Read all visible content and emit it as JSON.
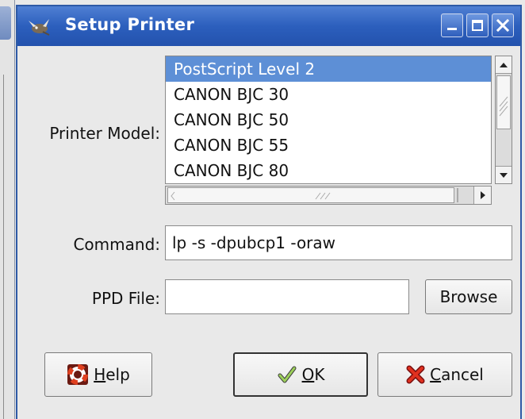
{
  "window": {
    "title": "Setup Printer"
  },
  "form": {
    "printer_model_label": "Printer Model:",
    "printer_models": [
      {
        "label": "PostScript Level 2",
        "selected": true
      },
      {
        "label": "CANON BJC 30",
        "selected": false
      },
      {
        "label": "CANON BJC 50",
        "selected": false
      },
      {
        "label": "CANON BJC 55",
        "selected": false
      },
      {
        "label": "CANON BJC 80",
        "selected": false
      }
    ],
    "command_label": "Command:",
    "command_value": "lp -s -dpubcp1 -oraw",
    "ppd_label": "PPD File:",
    "ppd_value": "",
    "browse_label": "Browse"
  },
  "buttons": {
    "help_label": "Help",
    "ok_label": "OK",
    "cancel_label": "Cancel"
  },
  "icons": {
    "title": "gimp-wilber-icon",
    "minimize": "minimize-icon",
    "maximize": "maximize-icon",
    "close": "close-icon",
    "help": "lifebuoy-icon",
    "ok": "checkmark-icon",
    "cancel": "red-x-icon"
  },
  "colors": {
    "titlebar": "#2c5fbd",
    "selection": "#5d8fd6"
  }
}
